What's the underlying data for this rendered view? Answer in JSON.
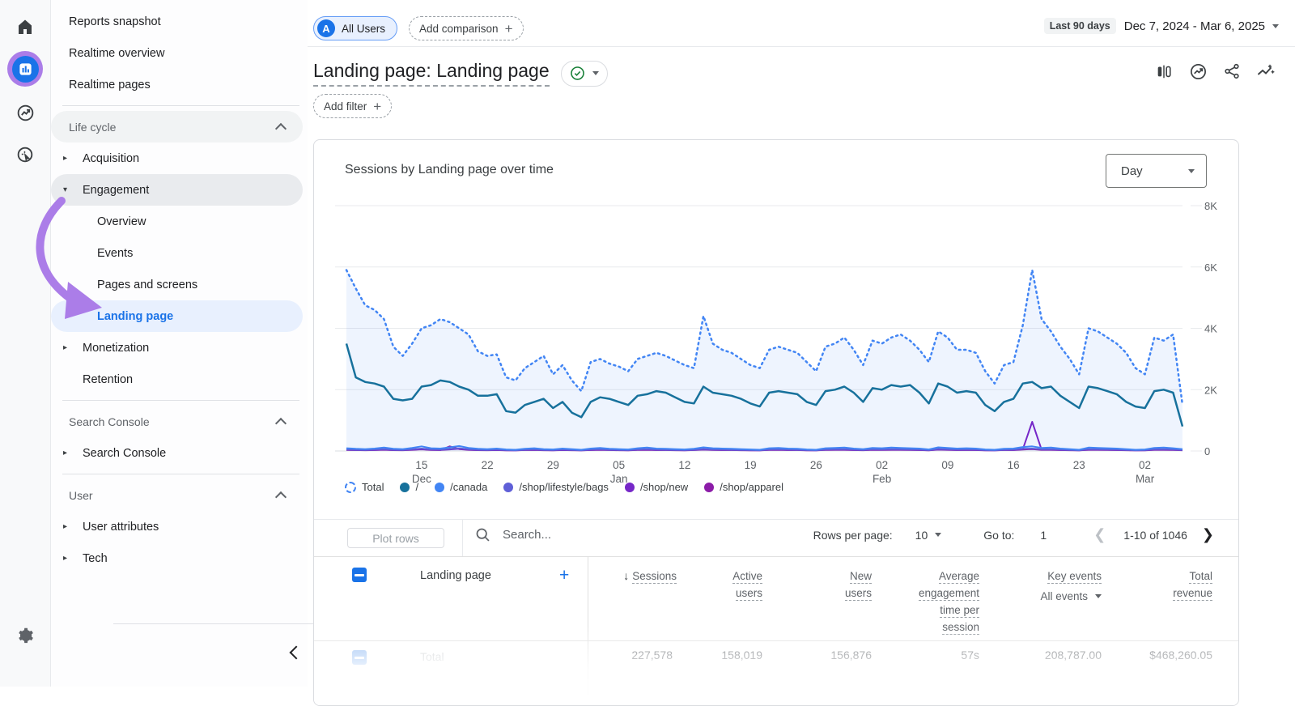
{
  "rail": {
    "icons": [
      "home",
      "reports",
      "advertising",
      "explore",
      "admin-gear"
    ]
  },
  "sidebar": {
    "entries": [
      {
        "type": "item",
        "label": "Reports snapshot",
        "level": 0
      },
      {
        "type": "item",
        "label": "Realtime overview",
        "level": 0
      },
      {
        "type": "item",
        "label": "Realtime pages",
        "level": 0
      },
      {
        "type": "divider"
      },
      {
        "type": "header",
        "label": "Life cycle",
        "pill": true
      },
      {
        "type": "item",
        "label": "Acquisition",
        "level": 1,
        "tri": "right"
      },
      {
        "type": "item",
        "label": "Engagement",
        "level": 1,
        "tri": "down",
        "graypill": true
      },
      {
        "type": "item",
        "label": "Overview",
        "level": 2
      },
      {
        "type": "item",
        "label": "Events",
        "level": 2
      },
      {
        "type": "item",
        "label": "Pages and screens",
        "level": 2
      },
      {
        "type": "item",
        "label": "Landing page",
        "level": 2,
        "selected": true
      },
      {
        "type": "item",
        "label": "Monetization",
        "level": 1,
        "tri": "right"
      },
      {
        "type": "item",
        "label": "Retention",
        "level": 1
      },
      {
        "type": "divider"
      },
      {
        "type": "header",
        "label": "Search Console"
      },
      {
        "type": "item",
        "label": "Search Console",
        "level": 1,
        "tri": "right"
      },
      {
        "type": "divider"
      },
      {
        "type": "header",
        "label": "User"
      },
      {
        "type": "item",
        "label": "User attributes",
        "level": 1,
        "tri": "right"
      },
      {
        "type": "item",
        "label": "Tech",
        "level": 1,
        "tri": "right"
      }
    ]
  },
  "topbar": {
    "all_users_label": "All Users",
    "all_users_initial": "A",
    "add_comparison_label": "Add comparison",
    "plus": "+",
    "last_range_label": "Last 90 days",
    "date_range": "Dec 7, 2024 - Mar 6, 2025"
  },
  "report_header": {
    "title": "Landing page: Landing page",
    "add_filter_label": "Add filter",
    "icons": [
      "comparison",
      "insights",
      "share",
      "sparkline"
    ]
  },
  "chart_card": {
    "title": "Sessions by Landing page over time",
    "granularity": "Day"
  },
  "chart_data": {
    "type": "line",
    "title": "Sessions by Landing page over time",
    "x_start": "Dec 7, 2024",
    "x_end": "Mar 6, 2025",
    "granularity": "Day",
    "ylim": [
      0,
      8000
    ],
    "yticks": [
      {
        "v": 0,
        "label": "0"
      },
      {
        "v": 2000,
        "label": "2K"
      },
      {
        "v": 4000,
        "label": "4K"
      },
      {
        "v": 6000,
        "label": "6K"
      },
      {
        "v": 8000,
        "label": "8K"
      }
    ],
    "xticks": [
      {
        "i": 8,
        "label": "15",
        "sub": "Dec"
      },
      {
        "i": 15,
        "label": "22"
      },
      {
        "i": 22,
        "label": "29"
      },
      {
        "i": 29,
        "label": "05",
        "sub": "Jan"
      },
      {
        "i": 36,
        "label": "12"
      },
      {
        "i": 43,
        "label": "19"
      },
      {
        "i": 50,
        "label": "26"
      },
      {
        "i": 57,
        "label": "02",
        "sub": "Feb"
      },
      {
        "i": 64,
        "label": "09"
      },
      {
        "i": 71,
        "label": "16"
      },
      {
        "i": 78,
        "label": "23"
      },
      {
        "i": 85,
        "label": "02",
        "sub": "Mar"
      }
    ],
    "series": [
      {
        "name": "Total",
        "color": "#4285f4",
        "style": "dotted",
        "fill": true,
        "values": [
          5900,
          5300,
          4750,
          4600,
          4300,
          3400,
          3100,
          3500,
          4000,
          4100,
          4300,
          4200,
          4000,
          3800,
          3250,
          3100,
          3150,
          2400,
          2300,
          2700,
          2900,
          3100,
          2500,
          2800,
          2300,
          1950,
          2900,
          3000,
          2850,
          2750,
          2600,
          3000,
          3100,
          3200,
          3100,
          2950,
          2800,
          2700,
          4400,
          3500,
          3300,
          3200,
          3000,
          2800,
          2700,
          3300,
          3400,
          3300,
          3200,
          2900,
          2600,
          3400,
          3500,
          3700,
          3300,
          2800,
          3600,
          3500,
          3700,
          3800,
          3600,
          3300,
          2900,
          3900,
          3700,
          3300,
          3300,
          3200,
          2600,
          2200,
          2800,
          2900,
          4100,
          5900,
          4300,
          3900,
          3400,
          3000,
          2500,
          4000,
          3900,
          3700,
          3500,
          3200,
          2700,
          2500,
          3700,
          3600,
          3800,
          1500
        ]
      },
      {
        "name": "/",
        "color": "#17719c",
        "style": "solid",
        "values": [
          3500,
          2400,
          2250,
          2200,
          2100,
          1700,
          1650,
          1700,
          2100,
          2150,
          2300,
          2250,
          2100,
          2000,
          1800,
          1800,
          1850,
          1300,
          1250,
          1500,
          1600,
          1700,
          1400,
          1600,
          1250,
          1100,
          1600,
          1750,
          1700,
          1600,
          1500,
          1800,
          1850,
          1950,
          1900,
          1750,
          1600,
          1550,
          2100,
          1900,
          1850,
          1800,
          1700,
          1550,
          1450,
          1900,
          1950,
          1900,
          1850,
          1600,
          1500,
          1950,
          2000,
          2100,
          1900,
          1600,
          2050,
          2000,
          2150,
          2100,
          2150,
          1900,
          1550,
          2200,
          2100,
          1900,
          1950,
          1900,
          1500,
          1300,
          1600,
          1700,
          2200,
          2250,
          2050,
          2100,
          1800,
          1600,
          1400,
          2100,
          2050,
          1950,
          1850,
          1600,
          1450,
          1400,
          1950,
          2000,
          1900,
          800
        ]
      },
      {
        "name": "/canada",
        "color": "#4285f4",
        "style": "solid",
        "values": [
          90,
          70,
          60,
          80,
          110,
          70,
          60,
          100,
          150,
          90,
          80,
          120,
          160,
          100,
          70,
          60,
          80,
          50,
          40,
          70,
          90,
          60,
          50,
          80,
          60,
          40,
          80,
          100,
          70,
          60,
          50,
          90,
          110,
          80,
          70,
          60,
          50,
          70,
          120,
          90,
          80,
          70,
          60,
          50,
          40,
          90,
          100,
          80,
          70,
          50,
          40,
          90,
          100,
          110,
          80,
          60,
          100,
          90,
          110,
          100,
          90,
          80,
          50,
          120,
          100,
          80,
          90,
          80,
          50,
          40,
          70,
          80,
          130,
          150,
          100,
          110,
          80,
          60,
          40,
          110,
          100,
          90,
          80,
          60,
          40,
          50,
          100,
          110,
          90,
          60
        ]
      },
      {
        "name": "/shop/lifestyle/bags",
        "color": "#5f5fd7",
        "style": "solid",
        "values": [
          50,
          40,
          35,
          45,
          60,
          40,
          35,
          55,
          80,
          50,
          45,
          65,
          90,
          55,
          40,
          35,
          45,
          30,
          25,
          40,
          50,
          35,
          30,
          45,
          35,
          25,
          45,
          55,
          40,
          35,
          30,
          50,
          60,
          45,
          40,
          35,
          30,
          40,
          65,
          50,
          45,
          40,
          35,
          30,
          25,
          50,
          55,
          45,
          40,
          30,
          25,
          50,
          55,
          60,
          45,
          35,
          55,
          50,
          60,
          55,
          50,
          45,
          30,
          65,
          55,
          45,
          50,
          45,
          30,
          25,
          40,
          45,
          70,
          80,
          55,
          60,
          45,
          35,
          25,
          60,
          55,
          50,
          45,
          35,
          25,
          30,
          55,
          60,
          50,
          35
        ]
      },
      {
        "name": "/shop/new",
        "color": "#7627c8",
        "style": "solid",
        "values": [
          40,
          30,
          28,
          35,
          45,
          30,
          28,
          42,
          60,
          40,
          35,
          50,
          70,
          42,
          30,
          28,
          35,
          24,
          20,
          32,
          40,
          28,
          24,
          35,
          28,
          20,
          35,
          42,
          32,
          28,
          24,
          40,
          45,
          35,
          32,
          28,
          24,
          32,
          50,
          40,
          35,
          32,
          28,
          24,
          20,
          40,
          42,
          35,
          32,
          24,
          20,
          40,
          42,
          45,
          35,
          28,
          42,
          40,
          45,
          42,
          40,
          35,
          24,
          50,
          42,
          35,
          40,
          35,
          24,
          20,
          32,
          35,
          55,
          950,
          42,
          45,
          35,
          28,
          20,
          45,
          42,
          40,
          35,
          28,
          20,
          24,
          42,
          45,
          40,
          28
        ]
      },
      {
        "name": "/shop/apparel",
        "color": "#8c1ca8",
        "style": "solid",
        "values": [
          35,
          28,
          24,
          30,
          40,
          26,
          24,
          36,
          52,
          34,
          30,
          150,
          60,
          36,
          26,
          24,
          30,
          20,
          18,
          28,
          34,
          24,
          20,
          30,
          24,
          18,
          30,
          36,
          28,
          24,
          20,
          34,
          38,
          30,
          28,
          24,
          20,
          28,
          44,
          34,
          30,
          28,
          24,
          20,
          18,
          34,
          36,
          30,
          28,
          20,
          18,
          34,
          36,
          38,
          30,
          24,
          36,
          34,
          38,
          36,
          34,
          30,
          20,
          44,
          36,
          30,
          34,
          30,
          20,
          18,
          28,
          30,
          48,
          60,
          36,
          38,
          30,
          24,
          18,
          38,
          36,
          34,
          30,
          24,
          18,
          20,
          36,
          38,
          34,
          24
        ]
      }
    ],
    "legend_position": "bottom",
    "grid": true
  },
  "table": {
    "plot_rows_label": "Plot rows",
    "search_placeholder": "Search...",
    "rows_per_page_label": "Rows per page:",
    "rows_per_page_value": "10",
    "goto_label": "Go to:",
    "goto_value": "1",
    "range_text": "1-10 of 1046",
    "dimension_header": "Landing page",
    "add_column": "+",
    "columns": [
      {
        "label": "Sessions",
        "sorted": true
      },
      {
        "label": "Active users"
      },
      {
        "label": "New users"
      },
      {
        "label": "Average engagement time per session"
      },
      {
        "label": "Key events",
        "sub": "All events"
      },
      {
        "label": "Total revenue"
      }
    ],
    "totals_label": "Total",
    "totals": [
      "227,578",
      "158,019",
      "156,876",
      "57s",
      "208,787.00",
      "$468,260.05"
    ]
  }
}
